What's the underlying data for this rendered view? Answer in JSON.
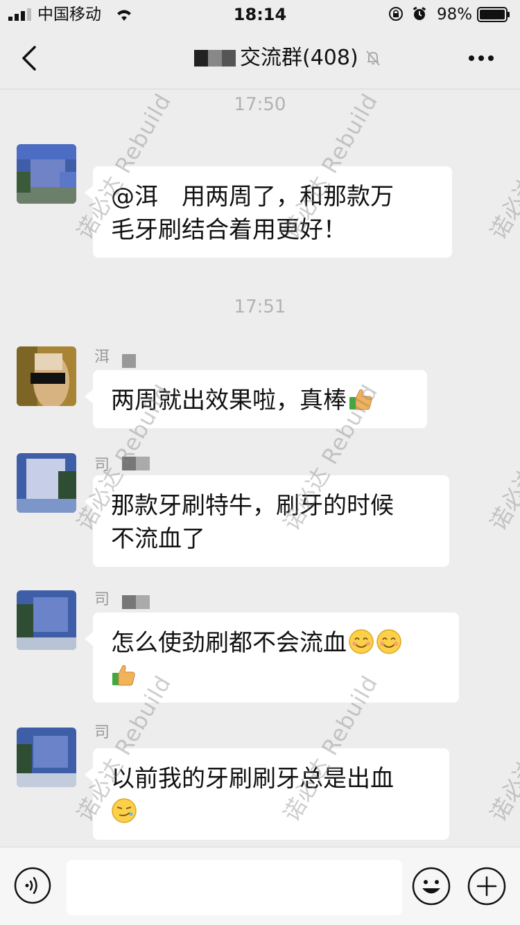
{
  "status_bar": {
    "carrier": "中国移动",
    "time": "18:14",
    "battery": "98%"
  },
  "nav": {
    "title": "交流群(408)"
  },
  "chat": {
    "timestamps": [
      "17:50",
      "17:51"
    ],
    "messages": [
      {
        "sender_initial": "",
        "text_line1": "@洱　用两周了，和那款万",
        "text_line2": "毛牙刷结合着用更好！"
      },
      {
        "sender_initial": "洱",
        "text": "两周就出效果啦，真棒"
      },
      {
        "sender_initial": "司",
        "text_line1": "那款牙刷特牛，刷牙的时候",
        "text_line2": "不流血了"
      },
      {
        "sender_initial": "司",
        "text_line1": "怎么使劲刷都不会流血"
      },
      {
        "sender_initial": "司",
        "text_line1": "以前我的牙刷刷牙总是出血"
      }
    ]
  },
  "watermark": "诺必达 Rebuild",
  "colors": {
    "background": "#ededed",
    "bubble": "#ffffff",
    "timestamp": "#b2b2b2"
  },
  "icons": [
    "signal-icon",
    "wifi-icon",
    "lock-rotation-icon",
    "alarm-icon",
    "battery-icon",
    "back-icon",
    "mute-icon",
    "more-icon",
    "voice-icon",
    "emoji-icon",
    "plus-icon",
    "thumbs-up-emoji",
    "smile-emoji",
    "smirk-emoji"
  ]
}
